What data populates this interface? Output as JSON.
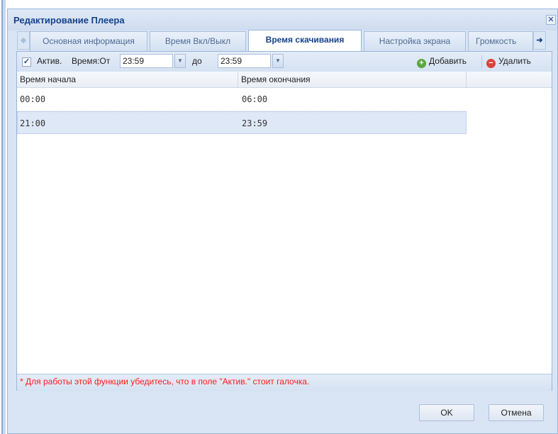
{
  "dialog": {
    "title": "Редактирование Плеера",
    "close_glyph": "✕"
  },
  "tabs": [
    {
      "label": "Основная информация",
      "active": false
    },
    {
      "label": "Время Вкл/Выкл",
      "active": false
    },
    {
      "label": "Время скачивания",
      "active": true
    },
    {
      "label": "Настройка экрана",
      "active": false
    },
    {
      "label": "Громкость",
      "active": false
    }
  ],
  "toolbar": {
    "active_checked": true,
    "active_label": "Актив.",
    "time_from_label": "Время:От",
    "time_from_value": "23:59",
    "to_label": "до",
    "time_to_value": "23:59",
    "add_label": "Добавить",
    "delete_label": "Удалить"
  },
  "grid": {
    "columns": [
      "Время начала",
      "Время окончания"
    ],
    "rows": [
      {
        "start": "00:00",
        "end": "06:00",
        "selected": false
      },
      {
        "start": "21:00",
        "end": "23:59",
        "selected": true
      }
    ]
  },
  "note": "* Для работы этой функции убедитесь, что в поле \"Актив.\" стоит галочка.",
  "buttons": {
    "ok": "OK",
    "cancel": "Отмена"
  },
  "colors": {
    "title": "#15428b",
    "note": "#ff1a1a",
    "selected_row": "#dfe8f6"
  }
}
